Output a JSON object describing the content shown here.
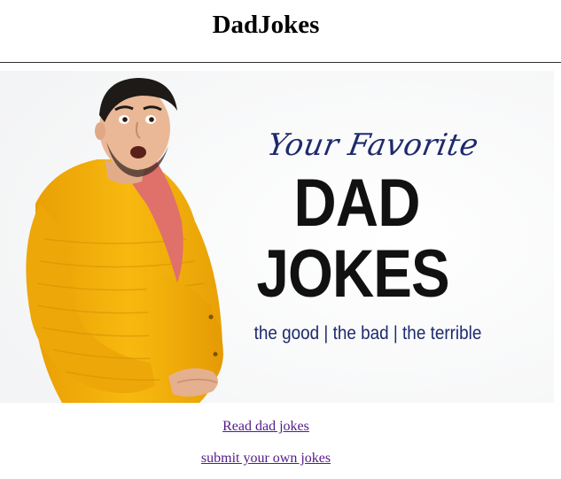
{
  "header": {
    "title": "DadJokes"
  },
  "hero": {
    "script_text": "Your Favorite",
    "headline_line1": "DAD",
    "headline_line2": "JOKES",
    "tagline": "the good | the bad | the terrible",
    "colors": {
      "navy": "#1e2a6b",
      "headline": "#111111",
      "cardigan": "#f3b20a",
      "shirt": "#e0706a"
    }
  },
  "nav": {
    "read_label": "Read dad jokes",
    "submit_label": "submit your own jokes",
    "link_color": "#551a8b"
  }
}
